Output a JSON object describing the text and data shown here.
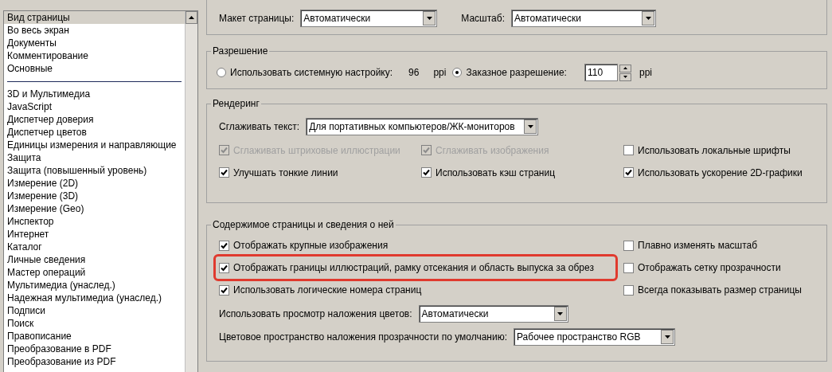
{
  "sidebar": {
    "items": [
      {
        "kind": "item",
        "label": "Вид страницы",
        "selected": true
      },
      {
        "kind": "item",
        "label": "Во весь экран",
        "selected": false
      },
      {
        "kind": "item",
        "label": "Документы",
        "selected": false
      },
      {
        "kind": "item",
        "label": "Комментирование",
        "selected": false
      },
      {
        "kind": "item",
        "label": "Основные",
        "selected": false
      },
      {
        "kind": "separator"
      },
      {
        "kind": "item",
        "label": "3D и Мультимедиа",
        "selected": false
      },
      {
        "kind": "item",
        "label": "JavaScript",
        "selected": false
      },
      {
        "kind": "item",
        "label": "Диспетчер доверия",
        "selected": false
      },
      {
        "kind": "item",
        "label": "Диспетчер цветов",
        "selected": false
      },
      {
        "kind": "item",
        "label": "Единицы измерения и направляющие",
        "selected": false
      },
      {
        "kind": "item",
        "label": "Защита",
        "selected": false
      },
      {
        "kind": "item",
        "label": "Защита (повышенный уровень)",
        "selected": false
      },
      {
        "kind": "item",
        "label": "Измерение (2D)",
        "selected": false
      },
      {
        "kind": "item",
        "label": "Измерение (3D)",
        "selected": false
      },
      {
        "kind": "item",
        "label": "Измерение (Geo)",
        "selected": false
      },
      {
        "kind": "item",
        "label": "Инспектор",
        "selected": false
      },
      {
        "kind": "item",
        "label": "Интернет",
        "selected": false
      },
      {
        "kind": "item",
        "label": "Каталог",
        "selected": false
      },
      {
        "kind": "item",
        "label": "Личные сведения",
        "selected": false
      },
      {
        "kind": "item",
        "label": "Мастер операций",
        "selected": false
      },
      {
        "kind": "item",
        "label": "Мультимедиа (унаслед.)",
        "selected": false
      },
      {
        "kind": "item",
        "label": "Надежная мультимедиа (унаслед.)",
        "selected": false
      },
      {
        "kind": "item",
        "label": "Подписи",
        "selected": false
      },
      {
        "kind": "item",
        "label": "Поиск",
        "selected": false
      },
      {
        "kind": "item",
        "label": "Правописание",
        "selected": false
      },
      {
        "kind": "item",
        "label": "Преобразование в PDF",
        "selected": false
      },
      {
        "kind": "item",
        "label": "Преобразование из PDF",
        "selected": false
      }
    ]
  },
  "layout": {
    "fields": [
      {
        "label": "Макет страницы:",
        "value": "Автоматически"
      },
      {
        "label": "Масштаб:",
        "value": "Автоматически"
      }
    ]
  },
  "resolution": {
    "title": "Разрешение",
    "options": [
      {
        "kind": "readout",
        "label": "Использовать системную настройку:",
        "selected": false,
        "value": "96",
        "unit": "ppi"
      },
      {
        "kind": "spinner",
        "label": "Заказное разрешение:",
        "selected": true,
        "value": "110",
        "unit": "ppi"
      }
    ]
  },
  "rendering": {
    "title": "Рендеринг",
    "smooth_text": {
      "label": "Сглаживать текст:",
      "value": "Для портативных компьютеров/ЖК-мониторов"
    },
    "checkboxes": [
      {
        "label": "Сглаживать штриховые иллюстрации",
        "checked": true,
        "disabled": true
      },
      {
        "label": "Сглаживать изображения",
        "checked": true,
        "disabled": true
      },
      {
        "label": "Использовать локальные шрифты",
        "checked": false,
        "disabled": false
      },
      {
        "label": "Улучшать тонкие линии",
        "checked": true,
        "disabled": false
      },
      {
        "label": "Использовать кэш страниц",
        "checked": true,
        "disabled": false
      },
      {
        "label": "Использовать ускорение 2D-графики",
        "checked": true,
        "disabled": false
      }
    ]
  },
  "page_content": {
    "title": "Содержимое страницы и сведения о ней",
    "checkboxes": [
      {
        "label": "Отображать крупные изображения",
        "checked": true,
        "highlighted": false
      },
      {
        "label": "Плавно изменять масштаб",
        "checked": false,
        "highlighted": false
      },
      {
        "label": "Отображать границы иллюстраций, рамку отсекания и область выпуска за обрез",
        "checked": true,
        "highlighted": true
      },
      {
        "label": "Отображать сетку прозрачности",
        "checked": false,
        "highlighted": false
      },
      {
        "label": "Использовать логические номера страниц",
        "checked": true,
        "highlighted": false
      },
      {
        "label": "Всегда показывать размер страницы",
        "checked": false,
        "highlighted": false
      }
    ],
    "dropdowns": [
      {
        "label": "Использовать просмотр наложения цветов:",
        "value": "Автоматически"
      },
      {
        "label": "Цветовое пространство наложения прозрачности по умолчанию:",
        "value": "Рабочее пространство RGB"
      }
    ]
  }
}
